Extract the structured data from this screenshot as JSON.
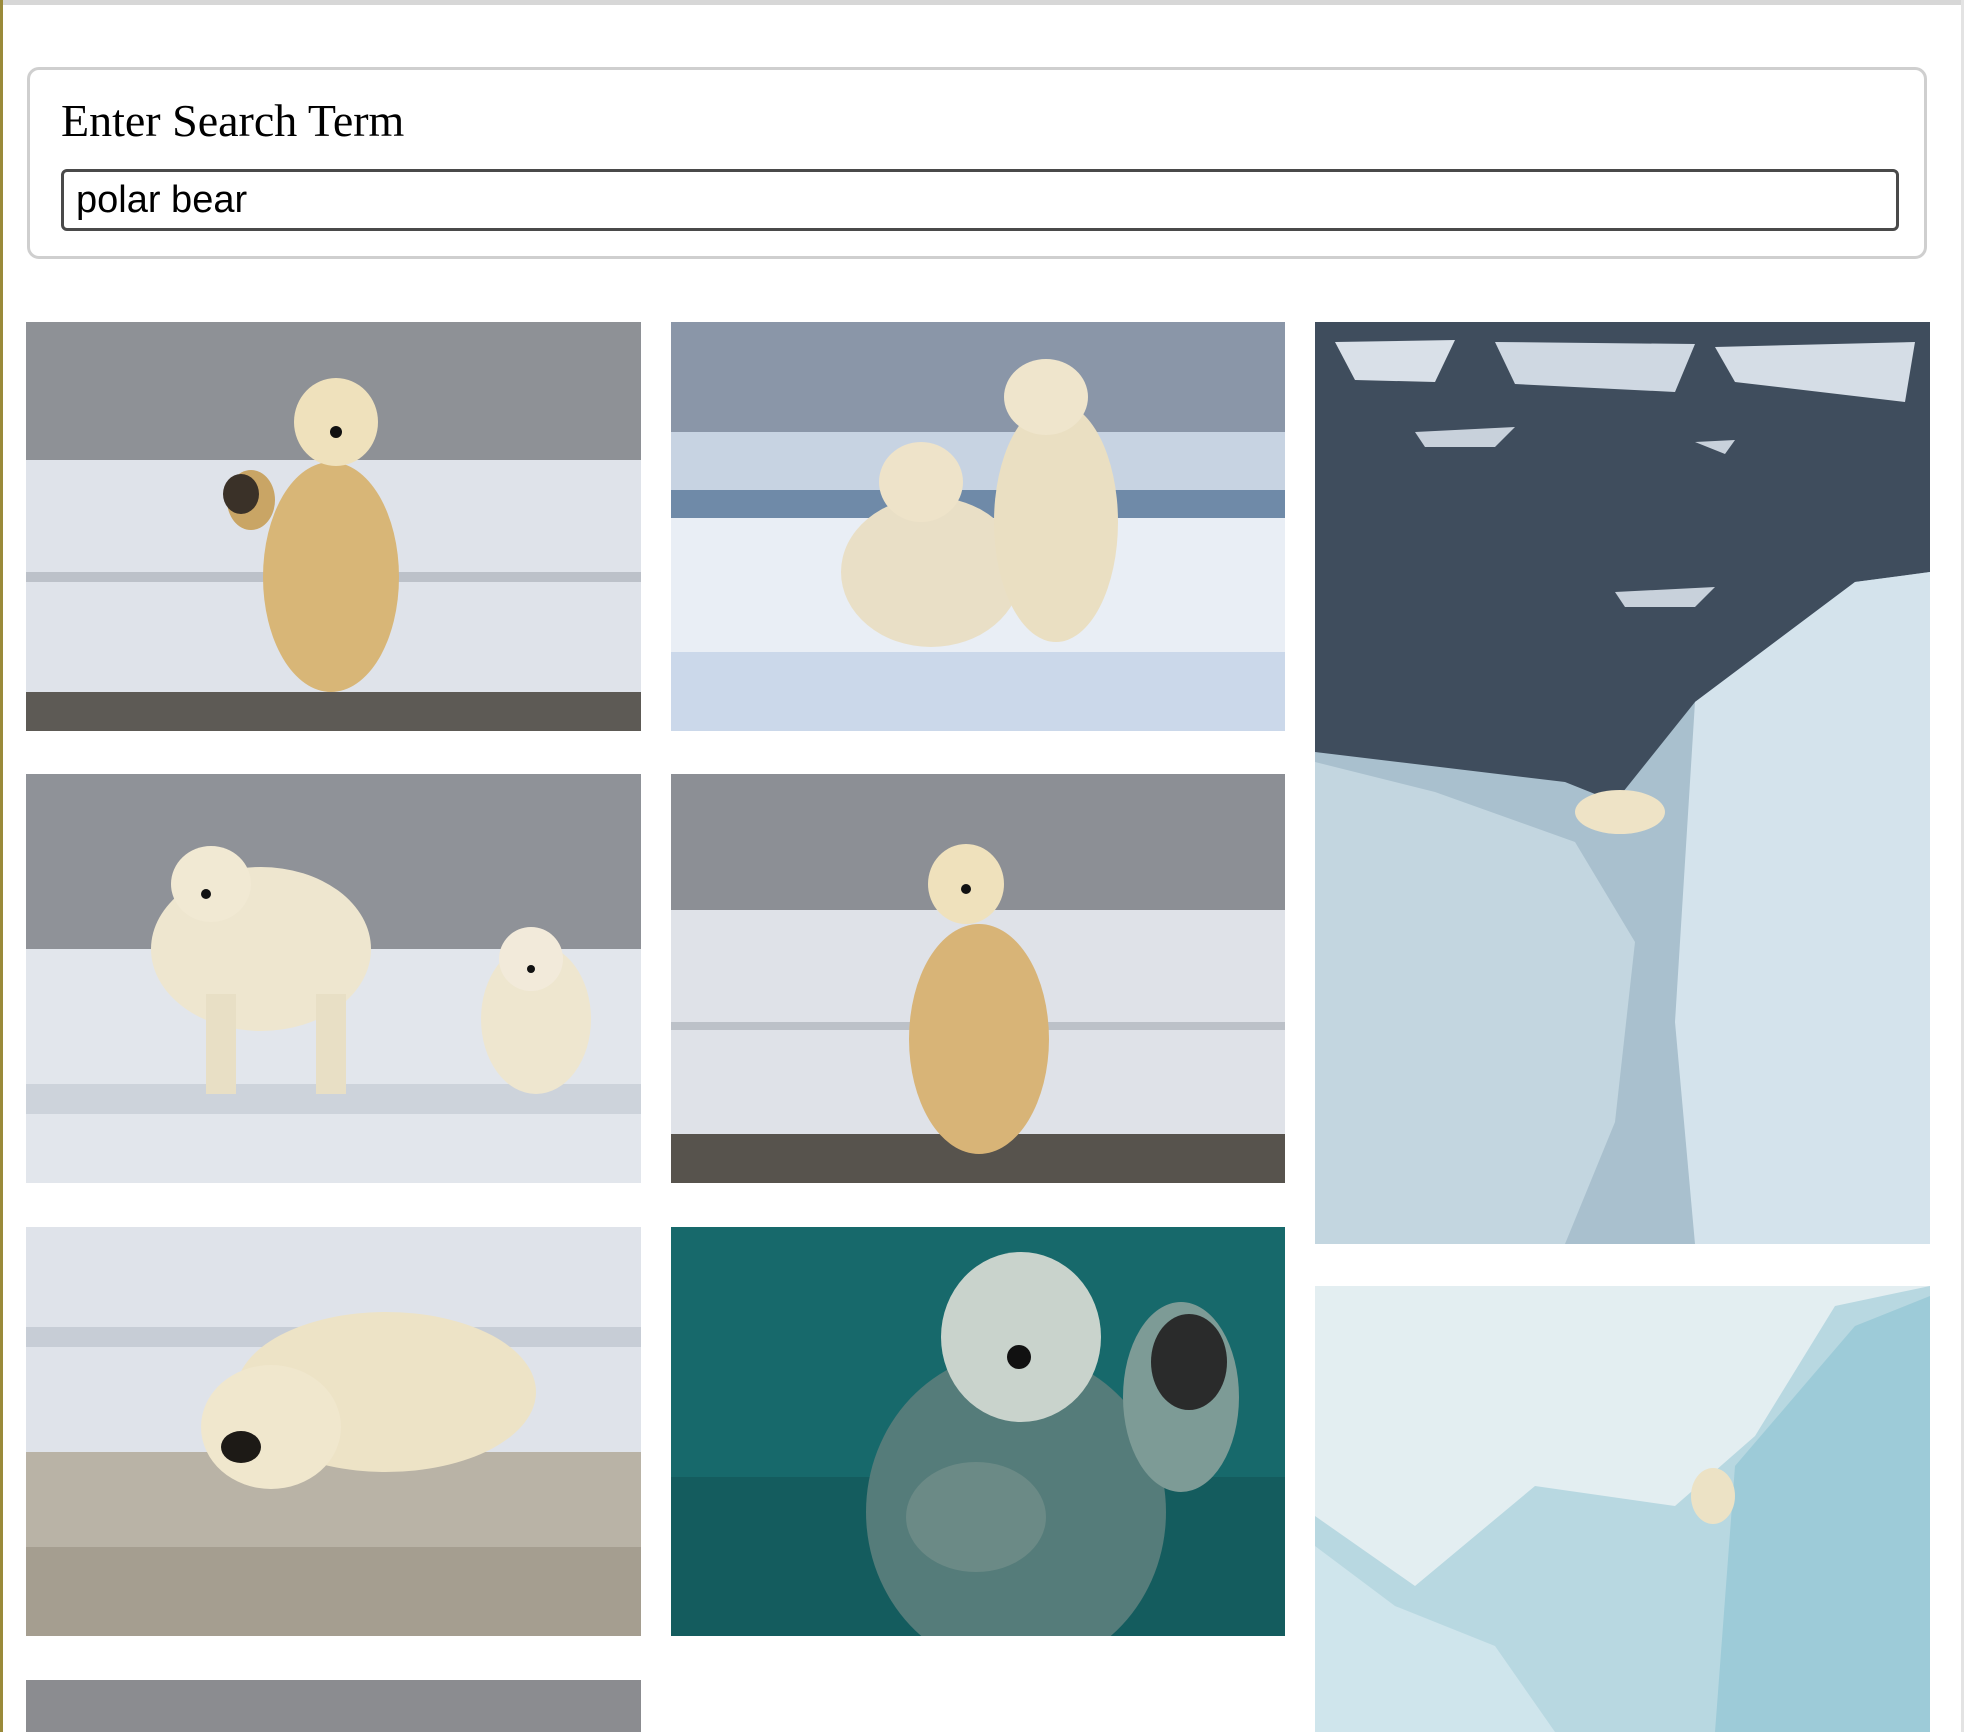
{
  "search": {
    "label": "Enter Search Term",
    "value": "polar bear"
  },
  "results": [
    {
      "icon": "polar-bear-waving-photo"
    },
    {
      "icon": "polar-bears-playing-photo"
    },
    {
      "icon": "polar-bear-on-iceberg-photo"
    },
    {
      "icon": "polar-bear-and-cub-photo"
    },
    {
      "icon": "polar-bear-standing-photo"
    },
    {
      "icon": "polar-bear-lying-on-ice-photo"
    },
    {
      "icon": "polar-bear-swimming-photo"
    },
    {
      "icon": "polar-bear-on-blue-ice-photo"
    },
    {
      "icon": "partial-image-photo"
    }
  ]
}
